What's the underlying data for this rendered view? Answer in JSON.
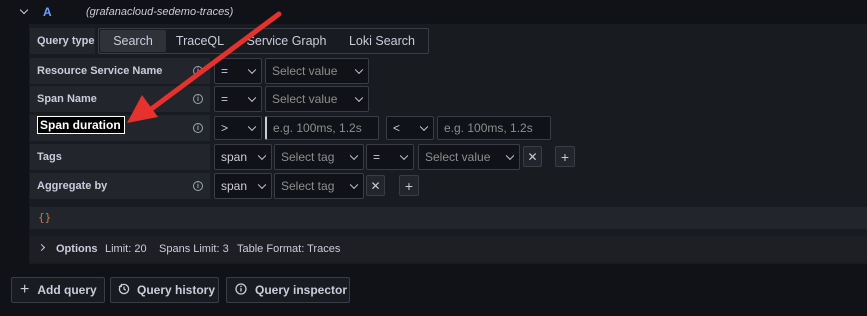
{
  "header": {
    "query_letter": "A",
    "datasource": "(grafanacloud-sedemo-traces)"
  },
  "query_type": {
    "label": "Query type",
    "tabs": [
      "Search",
      "TraceQL",
      "Service Graph",
      "Loki Search"
    ],
    "active": "Search"
  },
  "rows": {
    "resource_service": {
      "label": "Resource Service Name",
      "operator": "=",
      "value_placeholder": "Select value"
    },
    "span_name": {
      "label": "Span Name",
      "operator": "=",
      "value_placeholder": "Select value"
    },
    "span_duration": {
      "label": "Span duration",
      "min_operator": ">",
      "min_placeholder": "e.g. 100ms, 1.2s",
      "max_operator": "<",
      "max_placeholder": "e.g. 100ms, 1.2s"
    },
    "tags": {
      "label": "Tags",
      "scope": "span",
      "tag_placeholder": "Select tag",
      "operator": "=",
      "value_placeholder": "Select value"
    },
    "aggregate": {
      "label": "Aggregate by",
      "scope": "span",
      "tag_placeholder": "Select tag"
    }
  },
  "traceql_icon": "{}",
  "options": {
    "label": "Options",
    "limit": "Limit: 20",
    "spans_limit": "Spans Limit: 3",
    "table_format": "Table Format: Traces"
  },
  "footer": {
    "add_query": "Add query",
    "query_history": "Query history",
    "query_inspector": "Query inspector"
  },
  "colors": {
    "accent": "#6e9fff",
    "arrow": "#e5322d",
    "active_tab": "#2f3239"
  },
  "icons": {
    "collapse": "chevron-down-icon",
    "info": "info-icon",
    "remove": "close-icon",
    "add": "plus-icon",
    "history": "history-icon",
    "inspector": "info-circle-icon",
    "annotation": "red-arrow-icon"
  }
}
